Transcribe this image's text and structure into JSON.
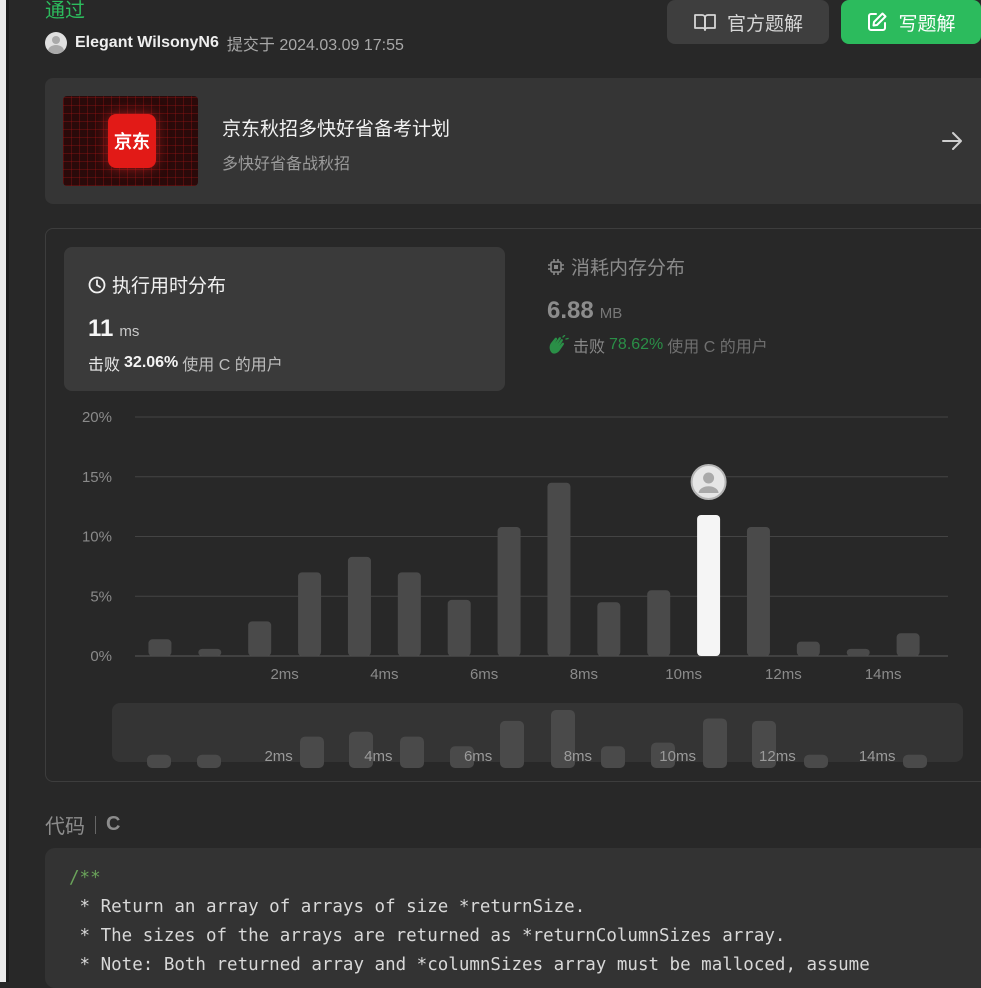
{
  "header": {
    "status": "通过",
    "username": "Elegant WilsonyN6",
    "submitted_at": "提交于 2024.03.09 17:55",
    "buttons": {
      "solution": "官方题解",
      "write": "写题解"
    }
  },
  "banner": {
    "logo_text": "京东",
    "title": "京东秋招多快好省备考计划",
    "subtitle": "多快好省备战秋招"
  },
  "runtime": {
    "title": "执行用时分布",
    "value": "11",
    "unit": "ms",
    "beat_prefix": "击败",
    "beat_pct": "32.06%",
    "beat_suffix": "使用 C 的用户"
  },
  "memory": {
    "title": "消耗内存分布",
    "value": "6.88",
    "unit": "MB",
    "beat_prefix": "击败",
    "beat_pct": "78.62%",
    "beat_suffix": "使用 C 的用户"
  },
  "colors": {
    "accent": "#2cbb5d",
    "bar": "#4a4a4a",
    "highlight_bar": "#f5f5f5",
    "mini_bar": "#4a4a4a"
  },
  "chart_data": {
    "type": "bar",
    "title": "执行用时分布",
    "x": [
      1,
      1.5,
      2,
      2.5,
      3,
      3.5,
      4,
      4.5,
      5,
      5.5,
      6,
      6.5,
      7,
      7.5,
      8,
      8.5,
      9,
      9.5,
      10,
      10.5,
      11,
      11.5,
      12,
      12.5,
      13,
      13.5,
      14,
      14.5,
      15
    ],
    "values": [
      1.4,
      0,
      0.6,
      0,
      2.9,
      0,
      7.0,
      0,
      8.3,
      0,
      7.0,
      0,
      4.7,
      0,
      10.8,
      0,
      14.5,
      0,
      4.5,
      0,
      5.5,
      0,
      11.8,
      0,
      10.8,
      0,
      1.2,
      0,
      0.6,
      0,
      1.9
    ],
    "bars": [
      {
        "x": 0.5,
        "value": 1.4
      },
      {
        "x": 1.5,
        "value": 0.6
      },
      {
        "x": 2.5,
        "value": 2.9
      },
      {
        "x": 3.5,
        "value": 7.0
      },
      {
        "x": 4.5,
        "value": 8.3
      },
      {
        "x": 5.5,
        "value": 7.0
      },
      {
        "x": 6.5,
        "value": 4.7
      },
      {
        "x": 7.5,
        "value": 10.8
      },
      {
        "x": 8.5,
        "value": 14.5
      },
      {
        "x": 9.5,
        "value": 4.5
      },
      {
        "x": 10.5,
        "value": 5.5
      },
      {
        "x": 11.5,
        "value": 11.8
      },
      {
        "x": 12.5,
        "value": 10.8
      },
      {
        "x": 13.5,
        "value": 1.2
      },
      {
        "x": 14.5,
        "value": 0.6
      },
      {
        "x": 15.5,
        "value": 1.9
      }
    ],
    "highlight_index": 11,
    "y_ticks": [
      "0%",
      "5%",
      "10%",
      "15%",
      "20%"
    ],
    "ylim": [
      0,
      20
    ],
    "x_ticks": [
      "2ms",
      "4ms",
      "6ms",
      "8ms",
      "10ms",
      "12ms",
      "14ms"
    ],
    "x_tick_values": [
      3,
      5,
      7,
      9,
      11,
      13,
      15
    ],
    "grid": true,
    "navigator": {
      "values": [
        0.6,
        0.6,
        0,
        2.1,
        2.5,
        2.1,
        1.3,
        3.4,
        4.3,
        1.3,
        1.6,
        3.6,
        3.4,
        0.6,
        0,
        0.6
      ],
      "x_ticks": [
        "2ms",
        "4ms",
        "6ms",
        "8ms",
        "10ms",
        "12ms",
        "14ms"
      ]
    }
  },
  "code": {
    "label": "代码",
    "language": "C",
    "lines": [
      "/**",
      " * Return an array of arrays of size *returnSize.",
      " * The sizes of the arrays are returned as *returnColumnSizes array.",
      " * Note: Both returned array and *columnSizes array must be malloced, assume"
    ]
  }
}
